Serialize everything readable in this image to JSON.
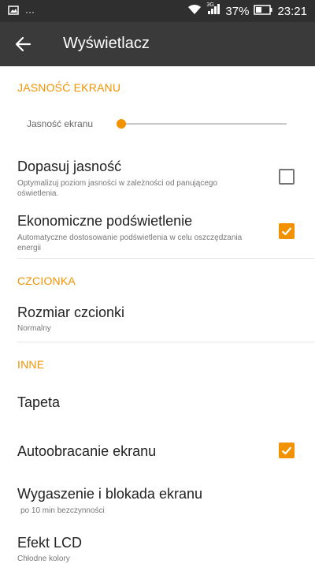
{
  "statusbar": {
    "battery_percent": "37%",
    "time": "23:21",
    "network": "3G",
    "overflow": "···"
  },
  "appbar": {
    "title": "Wyświetlacz"
  },
  "sections": {
    "brightness": "JASNOŚĆ EKRANU",
    "font": "CZCIONKA",
    "other": "INNE"
  },
  "brightness": {
    "label": "Jasność ekranu",
    "level": 0.0
  },
  "items": {
    "adaptive": {
      "title": "Dopasuj jasność",
      "subtitle": "Optymalizuj poziom jasności w zależności od panującego oświetlenia.",
      "checked": false
    },
    "eco": {
      "title": "Ekonomiczne podświetlenie",
      "subtitle": "Automatyczne dostosowanie podświetlenia w celu oszczędzania energii",
      "checked": true
    },
    "font_size": {
      "title": "Rozmiar czcionki",
      "subtitle": "Normalny"
    },
    "wallpaper": {
      "title": "Tapeta"
    },
    "autorotate": {
      "title": "Autoobracanie ekranu",
      "checked": true
    },
    "sleep": {
      "title": "Wygaszenie i blokada ekranu",
      "subtitle": "po 10 min bezczynności"
    },
    "lcd": {
      "title": "Efekt LCD",
      "subtitle": "Chłodne kolory"
    }
  },
  "colors": {
    "accent": "#f39200",
    "appbar": "#3a3a3a",
    "statusbar": "#2f2f2f"
  }
}
